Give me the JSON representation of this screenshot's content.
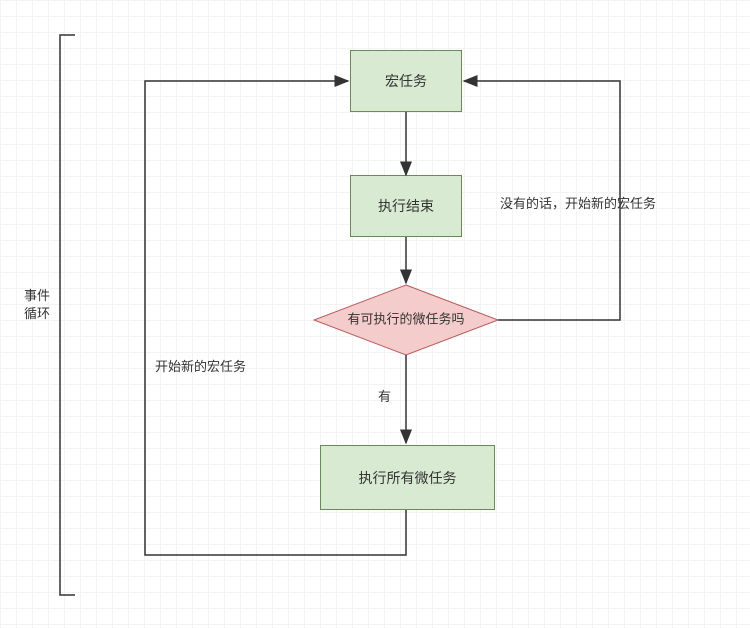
{
  "bracket_label": "事件\n循环",
  "nodes": {
    "macro_task": "宏任务",
    "exec_end": "执行结束",
    "decision": "有可执行的微任务吗",
    "exec_micro": "执行所有微任务"
  },
  "edges": {
    "no_branch": "没有的话，开始新的宏任务",
    "yes_branch": "有",
    "loop_back": "开始新的宏任务"
  }
}
